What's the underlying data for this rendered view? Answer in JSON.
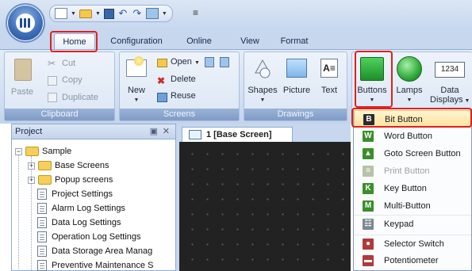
{
  "tabs": [
    "Home",
    "Configuration",
    "Online",
    "View",
    "Format"
  ],
  "clipboard": {
    "paste": "Paste",
    "cut": "Cut",
    "copy": "Copy",
    "duplicate": "Duplicate",
    "label": "Clipboard"
  },
  "screens": {
    "new": "New",
    "open": "Open",
    "delete": "Delete",
    "reuse": "Reuse",
    "label": "Screens"
  },
  "drawings": {
    "shapes": "Shapes",
    "picture": "Picture",
    "text": "Text",
    "label": "Drawings"
  },
  "parts": {
    "buttons": "Buttons",
    "lamps": "Lamps",
    "data_line1": "Data",
    "data_line2": "Displays",
    "data_icon": "1234"
  },
  "project": {
    "title": "Project",
    "pin": "\u0004",
    "close": "✕",
    "root": "Sample",
    "items": [
      "Base Screens",
      "Popup screens",
      "Project Settings",
      "Alarm Log Settings",
      "Data Log Settings",
      "Operation Log Settings",
      "Data Storage Area Manag",
      "Preventive Maintenance S"
    ]
  },
  "editor": {
    "tab_label": "1  [Base Screen]"
  },
  "dropdown": {
    "items": [
      {
        "label": "Bit Button",
        "glyph": "B",
        "color": "#2b2b2b",
        "state": "highlighted"
      },
      {
        "label": "Word Button",
        "glyph": "W",
        "color": "#3a8f2a",
        "state": "normal"
      },
      {
        "label": "Goto Screen Button",
        "glyph": "▲",
        "color": "#3a8f2a",
        "state": "normal"
      },
      {
        "label": "Print Button",
        "glyph": "≡",
        "color": "#b7c2a8",
        "state": "disabled"
      },
      {
        "label": "Key Button",
        "glyph": "K",
        "color": "#3a8f2a",
        "state": "normal"
      },
      {
        "label": "Multi-Button",
        "glyph": "M",
        "color": "#3a8f2a",
        "state": "normal"
      },
      {
        "label": "Keypad",
        "glyph": "☷",
        "color": "#7d8796",
        "state": "normal"
      },
      {
        "label": "Selector Switch",
        "glyph": "●",
        "color": "#b03a3a",
        "state": "normal"
      },
      {
        "label": "Potentiometer",
        "glyph": "▬",
        "color": "#b03a3a",
        "state": "normal"
      }
    ]
  },
  "colors": {
    "ribbon": "#dbe6f4",
    "highlight": "#ffe39b",
    "annotation_red": "#e02020",
    "button_green": "#2eaa3a"
  }
}
